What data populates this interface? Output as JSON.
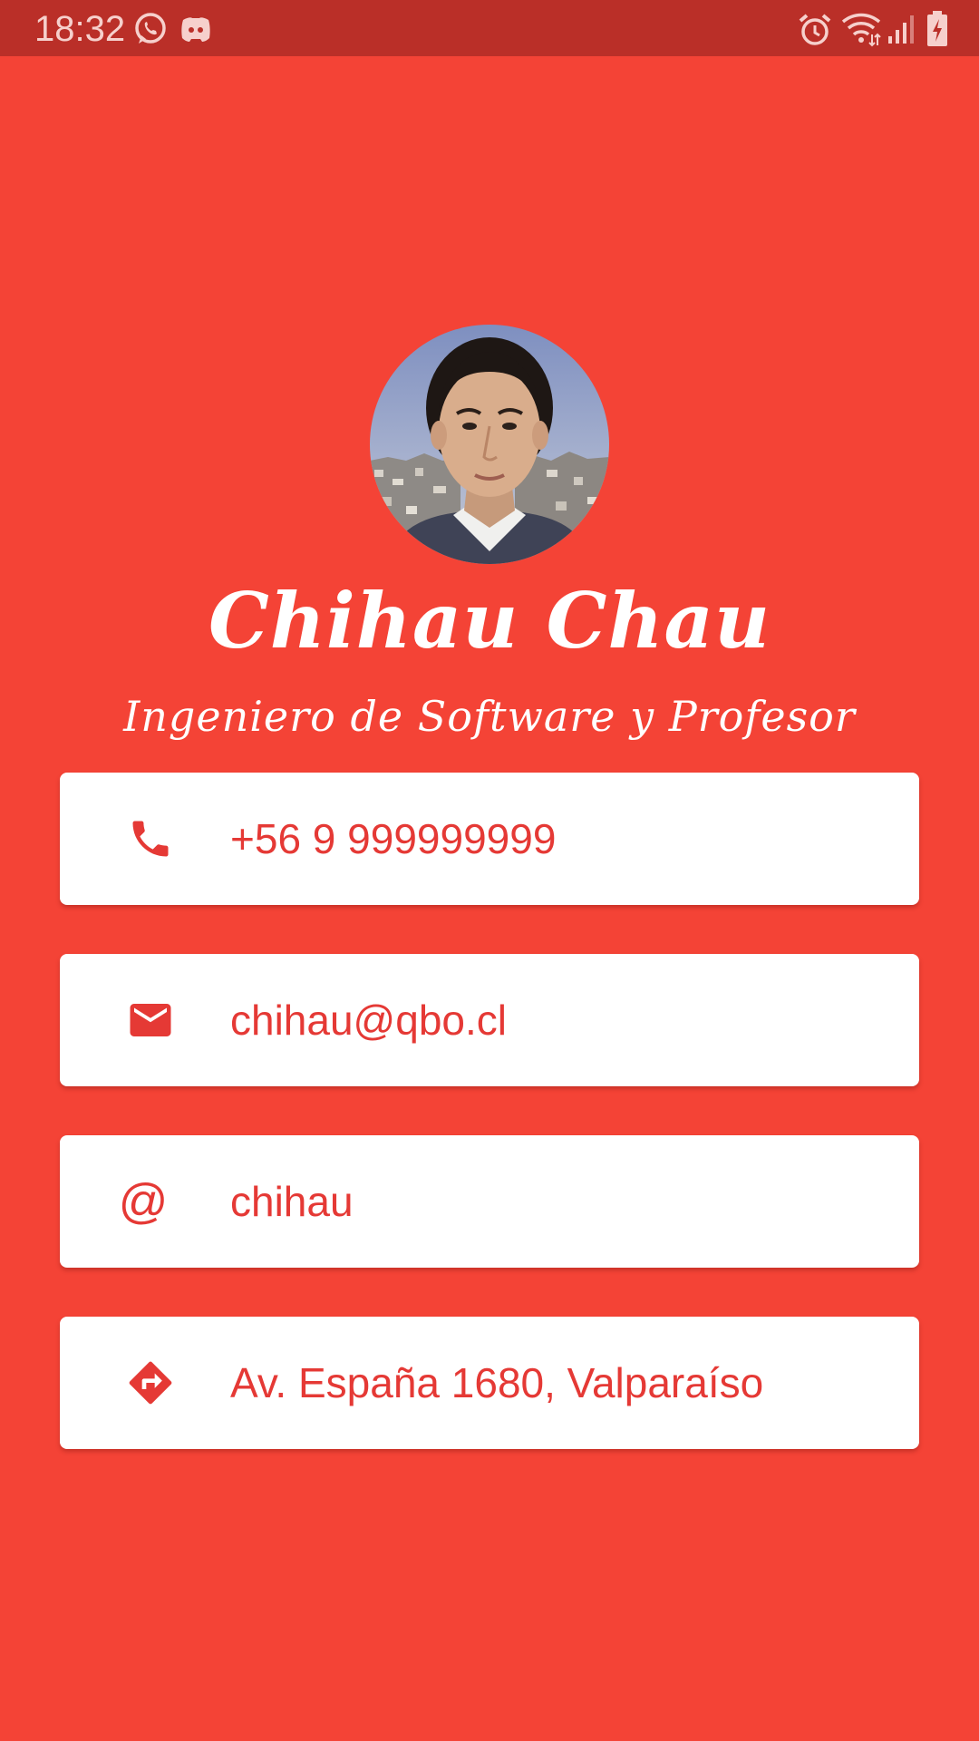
{
  "status_bar": {
    "time": "18:32",
    "left_icons": [
      "whatsapp-icon",
      "discord-icon"
    ],
    "right_icons": [
      "alarm-icon",
      "wifi-icon",
      "signal-icon",
      "battery-charging-icon"
    ]
  },
  "profile": {
    "avatar": "profile-photo",
    "name": "Chihau Chau",
    "title": "Ingeniero de Software y Profesor"
  },
  "contacts": [
    {
      "icon": "phone-icon",
      "text": "+56 9 999999999"
    },
    {
      "icon": "email-icon",
      "text": "chihau@qbo.cl"
    },
    {
      "icon": "at-icon",
      "symbol": "@",
      "text": "chihau"
    },
    {
      "icon": "directions-icon",
      "text": "Av. España 1680, Valparaíso"
    }
  ],
  "colors": {
    "background": "#F44336",
    "status_bar": "#BA2F28",
    "card": "#FFFFFF",
    "accent": "#E53935",
    "text_light": "#FFFFFF"
  }
}
